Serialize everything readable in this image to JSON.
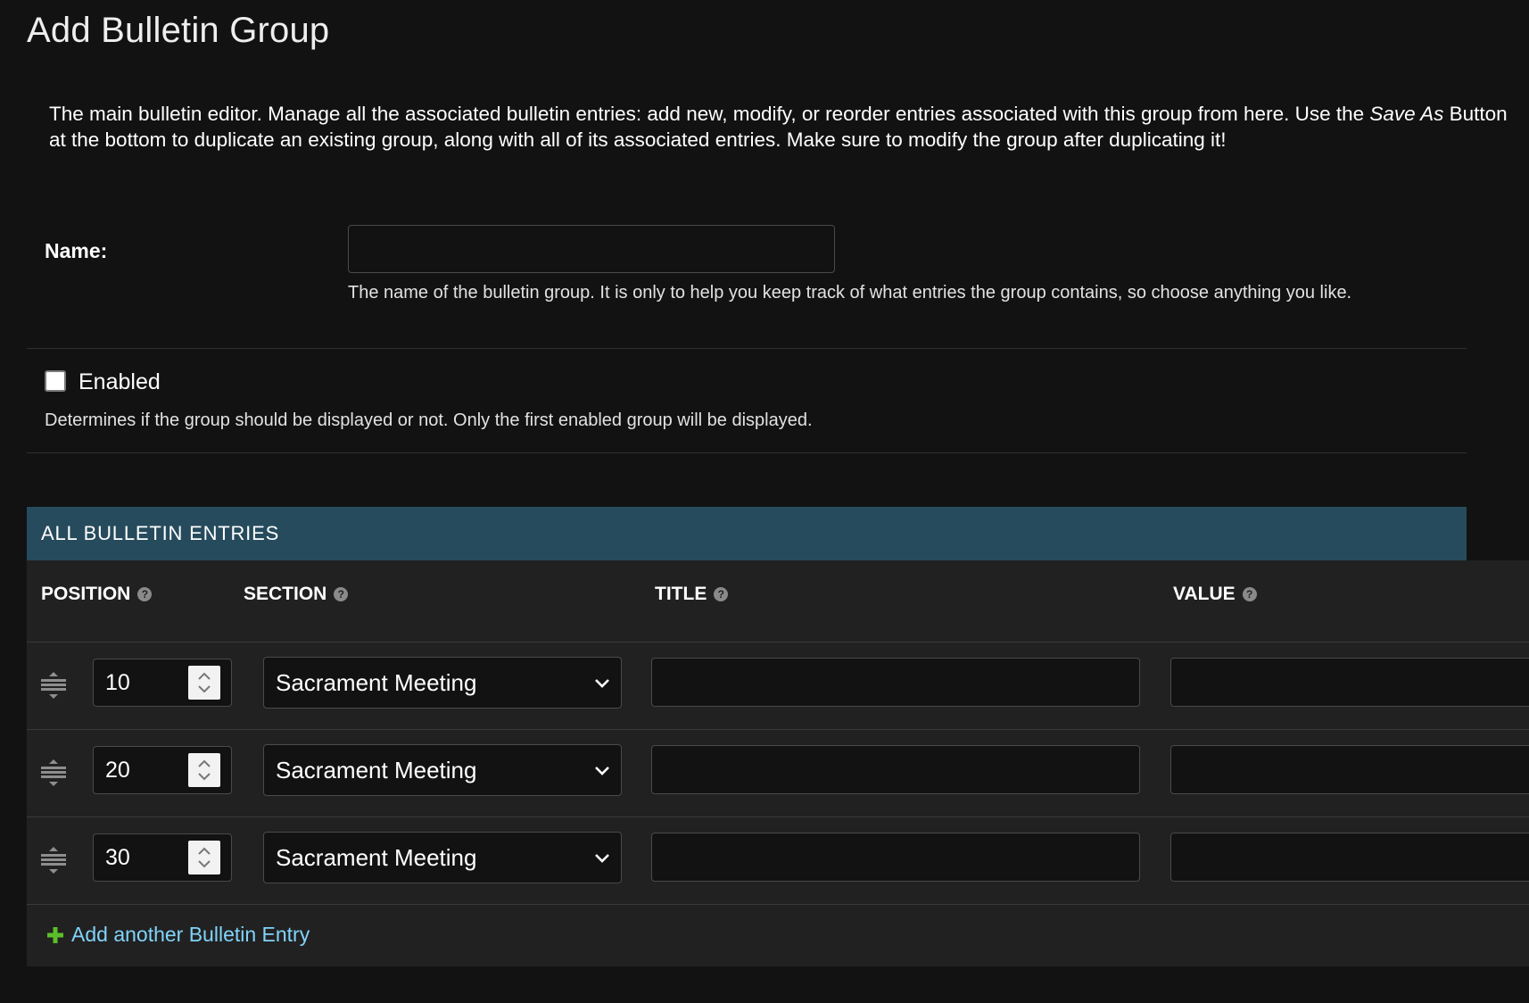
{
  "page": {
    "title": "Add Bulletin Group",
    "intro_part1": "The main bulletin editor. Manage all the associated bulletin entries: add new, modify, or reorder entries associated with this group from here. Use the ",
    "intro_emphasis": "Save As",
    "intro_part2": " Button at the bottom to duplicate an existing group, along with all of its associated entries. Make sure to modify the group after duplicating it!"
  },
  "form": {
    "name_label": "Name:",
    "name_value": "",
    "name_help": "The name of the bulletin group. It is only to help you keep track of what entries the group contains, so choose anything you like.",
    "enabled_label": "Enabled",
    "enabled_checked": false,
    "enabled_help": "Determines if the group should be displayed or not. Only the first enabled group will be displayed."
  },
  "inline": {
    "header": "ALL BULLETIN ENTRIES",
    "columns": {
      "position": "POSITION",
      "section": "SECTION",
      "title": "TITLE",
      "value": "VALUE"
    },
    "rows": [
      {
        "position": "10",
        "section": "Sacrament Meeting",
        "title": "",
        "value": ""
      },
      {
        "position": "20",
        "section": "Sacrament Meeting",
        "title": "",
        "value": ""
      },
      {
        "position": "30",
        "section": "Sacrament Meeting",
        "title": "",
        "value": ""
      }
    ],
    "add_label": "Add another Bulletin Entry"
  },
  "icons": {
    "help": "question-circle-icon",
    "drag": "drag-handle-icon",
    "chevron": "chevron-down-icon",
    "add": "plus-icon"
  },
  "colors": {
    "background": "#121212",
    "module_header": "#264b5d",
    "table_bg": "#212121",
    "link": "#81d4fa",
    "add_icon": "#5bbf29"
  }
}
